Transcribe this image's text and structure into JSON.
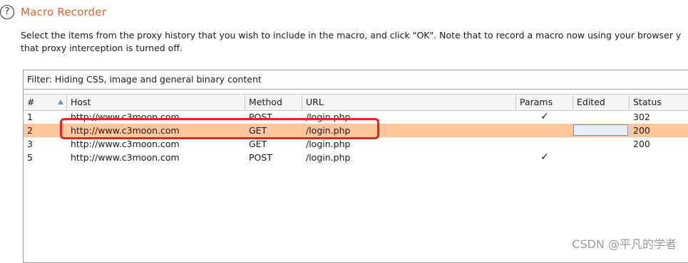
{
  "header": {
    "help_glyph": "?",
    "title": "Macro Recorder",
    "description_line1": "Select the items from the proxy history that you wish to include in the macro, and click \"OK\". Note that to record a macro now using your browser y",
    "description_line2": "that proxy interception is turned off."
  },
  "filter": {
    "text": "Filter: Hiding CSS, image and general binary content"
  },
  "table": {
    "columns": {
      "num": "#",
      "host": "Host",
      "method": "Method",
      "url": "URL",
      "params": "Params",
      "edited": "Edited",
      "status": "Status"
    },
    "rows": [
      {
        "num": "1",
        "host": "http://www.c3moon.com",
        "method": "POST",
        "url": "/login.php",
        "params": "✓",
        "edited": "",
        "status": "302",
        "selected": false
      },
      {
        "num": "2",
        "host": "http://www.c3moon.com",
        "method": "GET",
        "url": "/login.php",
        "params": "",
        "edited": "",
        "status": "200",
        "selected": true
      },
      {
        "num": "3",
        "host": "http://www.c3moon.com",
        "method": "GET",
        "url": "/login.php",
        "params": "",
        "edited": "",
        "status": "200",
        "selected": false
      },
      {
        "num": "5",
        "host": "http://www.c3moon.com",
        "method": "POST",
        "url": "/login.php",
        "params": "✓",
        "edited": "",
        "status": "",
        "selected": false
      }
    ]
  },
  "watermark": "CSDN @平凡的学者",
  "colors": {
    "title": "#e8622c",
    "selected_row": "#ffc59c",
    "highlight_box": "#e8241c"
  }
}
